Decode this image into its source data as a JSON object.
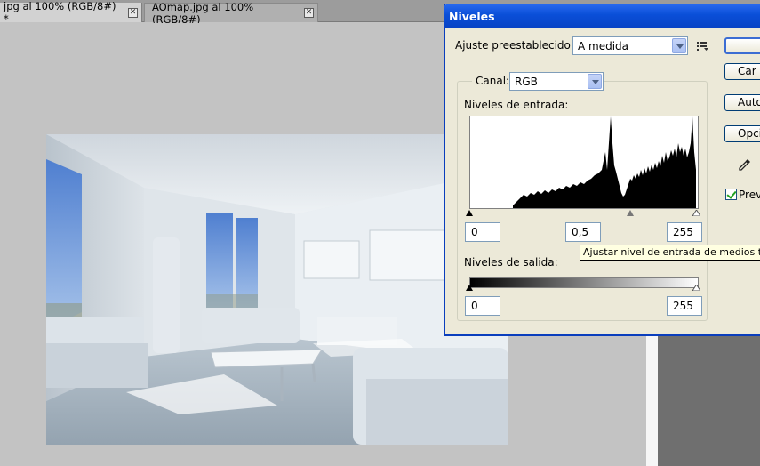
{
  "tabs": [
    {
      "label": "jpg al 100% (RGB/8#) *",
      "active": true
    },
    {
      "label": "AOmap.jpg al 100% (RGB/8#)",
      "active": false
    }
  ],
  "dialog": {
    "title": "Niveles",
    "preset_label": "Ajuste preestablecido:",
    "preset_value": "A medida",
    "channel_label": "Canal:",
    "channel_value": "RGB",
    "input_levels_label": "Niveles de entrada:",
    "input_black": "0",
    "input_gamma": "0,5",
    "input_white": "255",
    "output_levels_label": "Niveles de salida:",
    "output_black": "0",
    "output_white": "255",
    "tooltip": "Ajustar nivel de entrada de medios tonos",
    "buttons": {
      "ok": "",
      "cancel": "Car",
      "auto": "Auto",
      "options": "Opci"
    },
    "preview_label": "Previ",
    "preview_checked": true
  },
  "icons": {
    "close": "close-icon",
    "presets_menu": "presets-menu-icon",
    "eyedropper": "eyedropper-icon"
  },
  "colors": {
    "titlebar": "#0a4fd8",
    "dialog_bg": "#ece9d8",
    "tooltip_bg": "#ffffe1"
  }
}
